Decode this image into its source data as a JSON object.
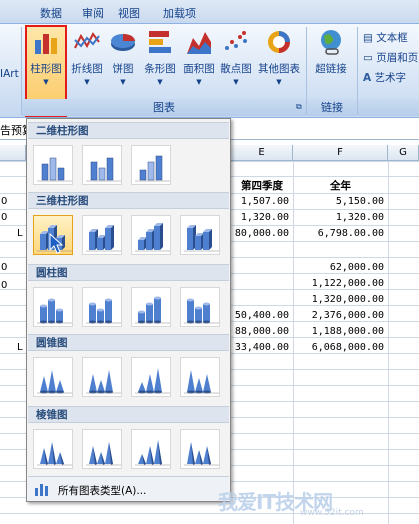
{
  "ribbon": {
    "tabs": [
      "数据",
      "审阅",
      "视图",
      "加载项"
    ],
    "art_fragment": "IArt",
    "buttons": [
      {
        "label": "柱形图"
      },
      {
        "label": "折线图"
      },
      {
        "label": "饼图"
      },
      {
        "label": "条形图"
      },
      {
        "label": "面积图"
      },
      {
        "label": "散点图"
      },
      {
        "label": "其他图表"
      },
      {
        "label": "超链接"
      }
    ],
    "group_chart": "图表",
    "group_link": "链接",
    "small_buttons": [
      "文本框",
      "页眉和页",
      "艺术字"
    ]
  },
  "sheet": {
    "name_fragment": "告预算",
    "col_headers": [
      "E",
      "F",
      "G"
    ],
    "header_cells": [
      "第四季度",
      "全年"
    ],
    "left_fragments": [
      "0",
      "0",
      "L",
      "0",
      "0",
      "L"
    ],
    "colE": [
      "1,507.00",
      "1,320.00",
      "80,000.00",
      "",
      "",
      "",
      "50,400.00",
      "88,000.00",
      "33,400.00"
    ],
    "colF": [
      "5,150.00",
      "1,320.00",
      "6,798.00.00",
      "",
      "62,000.00",
      "1,122,000.00",
      "1,320,000.00",
      "2,376,000.00",
      "1,188,000.00",
      "6,068,000.00"
    ]
  },
  "gallery": {
    "sections": [
      "二维柱形图",
      "三维柱形图",
      "圆柱图",
      "圆锥图",
      "棱锥图"
    ],
    "footer": "所有图表类型(A)..."
  },
  "watermark": {
    "text": "我爱IT技术网",
    "url": "www.52it.com"
  },
  "colors": {
    "accent": "#e21b1b",
    "highlight": "#fbc864",
    "ribbon": "#dbe7f6"
  }
}
